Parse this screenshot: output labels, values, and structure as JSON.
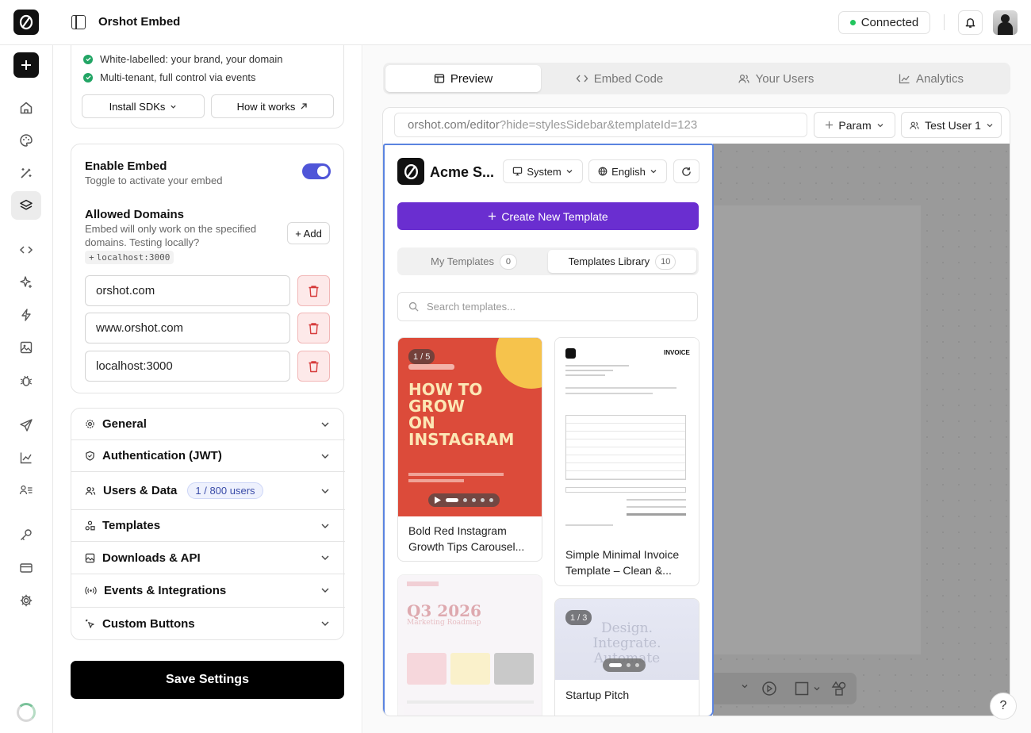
{
  "app": {
    "title": "Orshot Embed"
  },
  "header": {
    "status": "Connected",
    "status_color": "#22c55e"
  },
  "rail": {
    "items": [
      "home-icon",
      "palette-icon",
      "magic-wand-icon",
      "layers-icon",
      "code-icon",
      "sparkle-icon",
      "bolt-icon",
      "image-icon",
      "bug-icon",
      "send-icon",
      "chart-icon",
      "user-list-icon",
      "key-icon",
      "credit-card-icon",
      "gear-icon"
    ],
    "active": "layers-icon"
  },
  "features": {
    "items": [
      "White-labelled: your brand, your domain",
      "Multi-tenant, full control via events"
    ],
    "install_label": "Install SDKs",
    "how_label": "How it works"
  },
  "embed_settings": {
    "enable_title": "Enable Embed",
    "enable_sub": "Toggle to activate your embed",
    "enabled": true,
    "domains_title": "Allowed Domains",
    "domains_sub": "Embed will only work on the specified domains. Testing locally?",
    "local_chip": "localhost:3000",
    "add_label": "+ Add",
    "domains": [
      "orshot.com",
      "www.orshot.com",
      "localhost:3000"
    ]
  },
  "accordion": {
    "general": "General",
    "auth": "Authentication (JWT)",
    "users": "Users & Data",
    "users_badge": "1 / 800 users",
    "templates": "Templates",
    "downloads": "Downloads & API",
    "events": "Events & Integrations",
    "custom": "Custom Buttons"
  },
  "save_label": "Save Settings",
  "main_tabs": {
    "preview": "Preview",
    "embed_code": "Embed Code",
    "users": "Your Users",
    "analytics": "Analytics",
    "active": "Preview"
  },
  "browser": {
    "url_host": "orshot.com/editor",
    "url_query": "?hide=stylesSidebar&templateId=123",
    "param_label": "Param",
    "user_label": "Test User 1"
  },
  "embed_app": {
    "brand": "Acme S...",
    "theme": "System",
    "language": "English",
    "create_label": "Create New Template",
    "tab_mine": "My Templates",
    "tab_mine_count": "0",
    "tab_library": "Templates Library",
    "tab_library_count": "10",
    "search_placeholder": "Search templates...",
    "templates": [
      {
        "name": "Bold Red Instagram Growth Tips Carousel...",
        "pages": "1 / 5",
        "headline": "HOW TO GROW ON INSTAGRAM"
      },
      {
        "name": "Simple Minimal Invoice Template – Clean &...",
        "doc_label": "INVOICE"
      },
      {
        "name": "",
        "headline": "Q3 2026",
        "subline": "Marketing Roadmap"
      },
      {
        "name": "Startup Pitch",
        "pages": "1 / 3",
        "headline": "Design. Integrate. Automate"
      }
    ]
  },
  "help_label": "?"
}
